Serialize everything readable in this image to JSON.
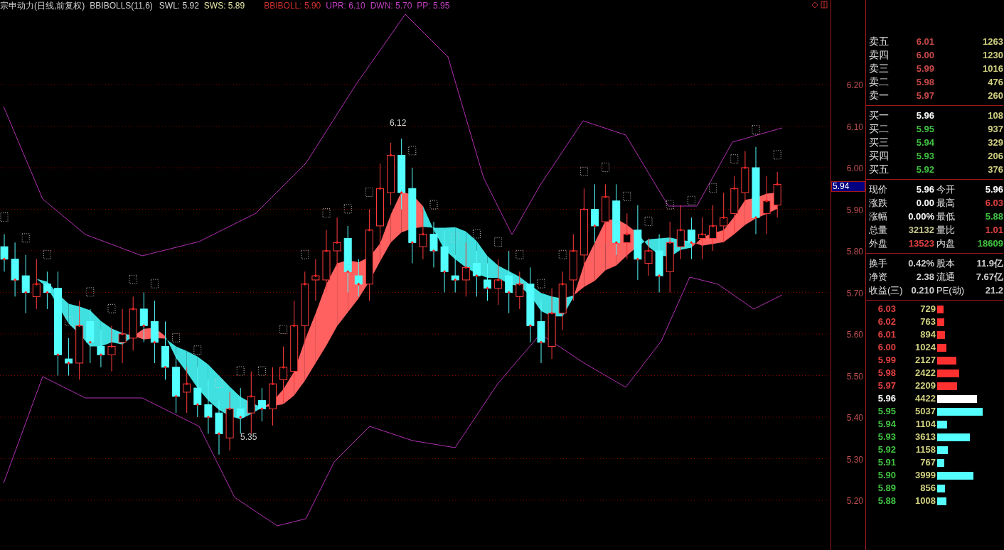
{
  "header": {
    "title": "宗申动力(日线,前复权)",
    "indicator": "BBIBOLLS(11,6)",
    "readings": [
      {
        "text": "SWL: 5.92",
        "color": "#d8d8d8"
      },
      {
        "text": "SWS: 5.89",
        "color": "#e8e8a8"
      },
      {
        "text": "BBIBOLL: 5.90",
        "color": "#d03030"
      },
      {
        "text": "UPR: 6.10",
        "color": "#c040c0"
      },
      {
        "text": "DWN: 5.70",
        "color": "#c040c0"
      },
      {
        "text": "PP: 5.95",
        "color": "#c040c0"
      }
    ]
  },
  "chart": {
    "annotations": [
      {
        "text": "6.12",
        "kind": "high"
      },
      {
        "text": "5.35",
        "kind": "low"
      }
    ]
  },
  "price_axis": {
    "ticks": [
      "6.20",
      "6.10",
      "6.00",
      "5.90",
      "5.80",
      "5.70",
      "5.60",
      "5.50",
      "5.40",
      "5.30",
      "5.20"
    ],
    "current_price": "5.94"
  },
  "order_book": {
    "asks": [
      {
        "label": "卖五",
        "price": "6.01",
        "volume": "1263"
      },
      {
        "label": "卖四",
        "price": "6.00",
        "volume": "1230"
      },
      {
        "label": "卖三",
        "price": "5.99",
        "volume": "1016"
      },
      {
        "label": "卖二",
        "price": "5.98",
        "volume": "476"
      },
      {
        "label": "卖一",
        "price": "5.97",
        "volume": "260"
      }
    ],
    "bids": [
      {
        "label": "买一",
        "price": "5.96",
        "volume": "108",
        "color": "#ffffff"
      },
      {
        "label": "买二",
        "price": "5.95",
        "volume": "937",
        "color": "#40c040"
      },
      {
        "label": "买三",
        "price": "5.94",
        "volume": "329",
        "color": "#40c040"
      },
      {
        "label": "买四",
        "price": "5.93",
        "volume": "206",
        "color": "#40c040"
      },
      {
        "label": "买五",
        "price": "5.92",
        "volume": "376",
        "color": "#40c040"
      }
    ]
  },
  "quote": [
    [
      [
        {
          "label": "现价",
          "value": "5.96",
          "color": "#ffffff"
        },
        {
          "label": "今开",
          "value": "5.96",
          "color": "#ffffff"
        }
      ],
      [
        {
          "label": "涨跌",
          "value": "0.00",
          "color": "#ffffff"
        },
        {
          "label": "最高",
          "value": "6.03",
          "color": "#e04040"
        }
      ],
      [
        {
          "label": "涨幅",
          "value": "0.00%",
          "color": "#ffffff"
        },
        {
          "label": "最低",
          "value": "5.88",
          "color": "#40c040"
        }
      ],
      [
        {
          "label": "总量",
          "value": "32132",
          "color": "#c8c890"
        },
        {
          "label": "量比",
          "value": "1.01",
          "color": "#e04040"
        }
      ],
      [
        {
          "label": "外盘",
          "value": "13523",
          "color": "#e04040"
        },
        {
          "label": "内盘",
          "value": "18609",
          "color": "#40c040"
        }
      ]
    ],
    [
      [
        {
          "label": "换手",
          "value": "0.42%",
          "color": "#d0d0d0"
        },
        {
          "label": "股本",
          "value": "11.9亿",
          "color": "#d0d0d0"
        }
      ],
      [
        {
          "label": "净资",
          "value": "2.38",
          "color": "#d0d0d0"
        },
        {
          "label": "流通",
          "value": "7.67亿",
          "color": "#d0d0d0"
        }
      ],
      [
        {
          "label": "收益(三)",
          "value": "0.210",
          "color": "#d0d0d0"
        },
        {
          "label": "PE(动)",
          "value": "21.2",
          "color": "#d0d0d0"
        }
      ]
    ]
  ],
  "depth": [
    {
      "price": "6.03",
      "volume": "729",
      "kind": "ask"
    },
    {
      "price": "6.02",
      "volume": "763",
      "kind": "ask"
    },
    {
      "price": "6.01",
      "volume": "894",
      "kind": "ask"
    },
    {
      "price": "6.00",
      "volume": "1024",
      "kind": "ask"
    },
    {
      "price": "5.99",
      "volume": "2127",
      "kind": "ask"
    },
    {
      "price": "5.98",
      "volume": "2422",
      "kind": "ask"
    },
    {
      "price": "5.97",
      "volume": "2209",
      "kind": "ask"
    },
    {
      "price": "5.96",
      "volume": "4422",
      "kind": "last"
    },
    {
      "price": "5.95",
      "volume": "5037",
      "kind": "bid"
    },
    {
      "price": "5.94",
      "volume": "1104",
      "kind": "bid"
    },
    {
      "price": "5.93",
      "volume": "3613",
      "kind": "bid"
    },
    {
      "price": "5.92",
      "volume": "1158",
      "kind": "bid"
    },
    {
      "price": "5.91",
      "volume": "767",
      "kind": "bid"
    },
    {
      "price": "5.90",
      "volume": "3999",
      "kind": "bid"
    },
    {
      "price": "5.89",
      "volume": "856",
      "kind": "bid"
    },
    {
      "price": "5.88",
      "volume": "1008",
      "kind": "bid"
    }
  ]
}
